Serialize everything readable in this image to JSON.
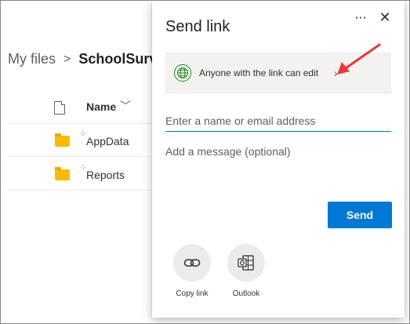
{
  "breadcrumb": {
    "root": "My files",
    "separator": ">",
    "current": "SchoolSurve"
  },
  "list": {
    "header_name": "Name",
    "header_caret": "﹀",
    "rows": [
      {
        "label": "AppData"
      },
      {
        "label": "Reports"
      }
    ]
  },
  "panel": {
    "title": "Send link",
    "more_label": "···",
    "close_label": "✕",
    "permission_text": "Anyone with the link can edit",
    "permission_chevron": "›",
    "name_placeholder": "Enter a name or email address",
    "message_placeholder": "Add a message (optional)",
    "send_label": "Send",
    "share_options": [
      {
        "label": "Copy link",
        "icon": "link-icon"
      },
      {
        "label": "Outlook",
        "icon": "outlook-icon"
      }
    ]
  },
  "colors": {
    "accent": "#0078d4",
    "input_underline": "#038387",
    "globe": "#107c10",
    "folder": "#ffb900",
    "annotation_arrow": "#e8373b"
  }
}
